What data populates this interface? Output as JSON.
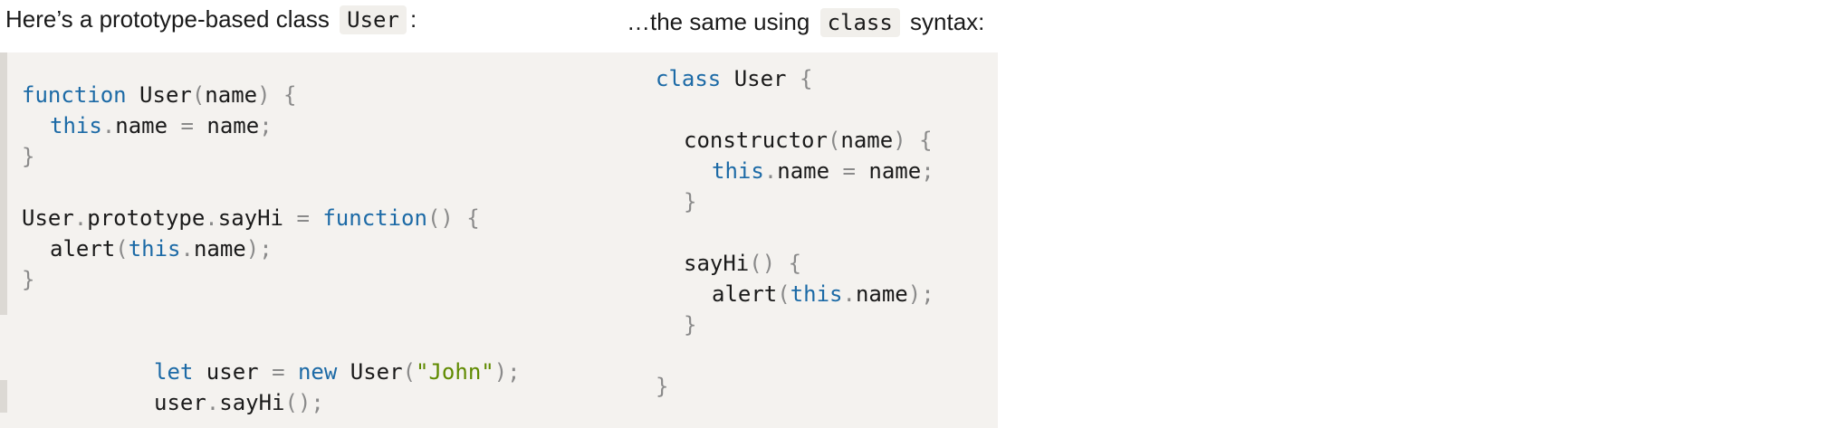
{
  "captions": {
    "left_prefix": "Here’s a prototype-based class ",
    "left_code": "User",
    "left_suffix": ":",
    "right_prefix": "…the same using ",
    "right_code": "class",
    "right_suffix": " syntax:"
  },
  "left_code": {
    "l1": {
      "kw": "function",
      "name": " User",
      "p1": "(",
      "arg": "name",
      "p2": ") {"
    },
    "l2": {
      "kw": "this",
      "dot": ".",
      "prop": "name",
      "op": " = ",
      "val": "name",
      "semi": ";"
    },
    "l3": {
      "brace": "}"
    },
    "l4": {
      "obj": "User",
      "d1": ".",
      "proto": "prototype",
      "d2": ".",
      "meth": "sayHi",
      "op": " = ",
      "kw": "function",
      "p": "() {"
    },
    "l5": {
      "fn": "alert",
      "p1": "(",
      "kw": "this",
      "dot": ".",
      "prop": "name",
      "p2": ");"
    },
    "l6": {
      "brace": "}"
    },
    "l7": {
      "kw1": "let",
      "v": " user ",
      "op": "=",
      "kw2": " new",
      "cls": " User",
      "p1": "(",
      "str": "\"John\"",
      "p2": ");"
    },
    "l8": {
      "obj": "user",
      "dot": ".",
      "meth": "sayHi",
      "p": "();"
    }
  },
  "right_code": {
    "l1": {
      "kw": "class",
      "name": " User ",
      "brace": "{"
    },
    "l2": {
      "ctor": "constructor",
      "p1": "(",
      "arg": "name",
      "p2": ") {"
    },
    "l3": {
      "kw": "this",
      "dot": ".",
      "prop": "name",
      "op": " = ",
      "val": "name",
      "semi": ";"
    },
    "l4": {
      "brace": "}"
    },
    "l5": {
      "meth": "sayHi",
      "p": "() {"
    },
    "l6": {
      "fn": "alert",
      "p1": "(",
      "kw": "this",
      "dot": ".",
      "prop": "name",
      "p2": ");"
    },
    "l7": {
      "brace": "}"
    },
    "l8": {
      "brace": "}"
    }
  }
}
